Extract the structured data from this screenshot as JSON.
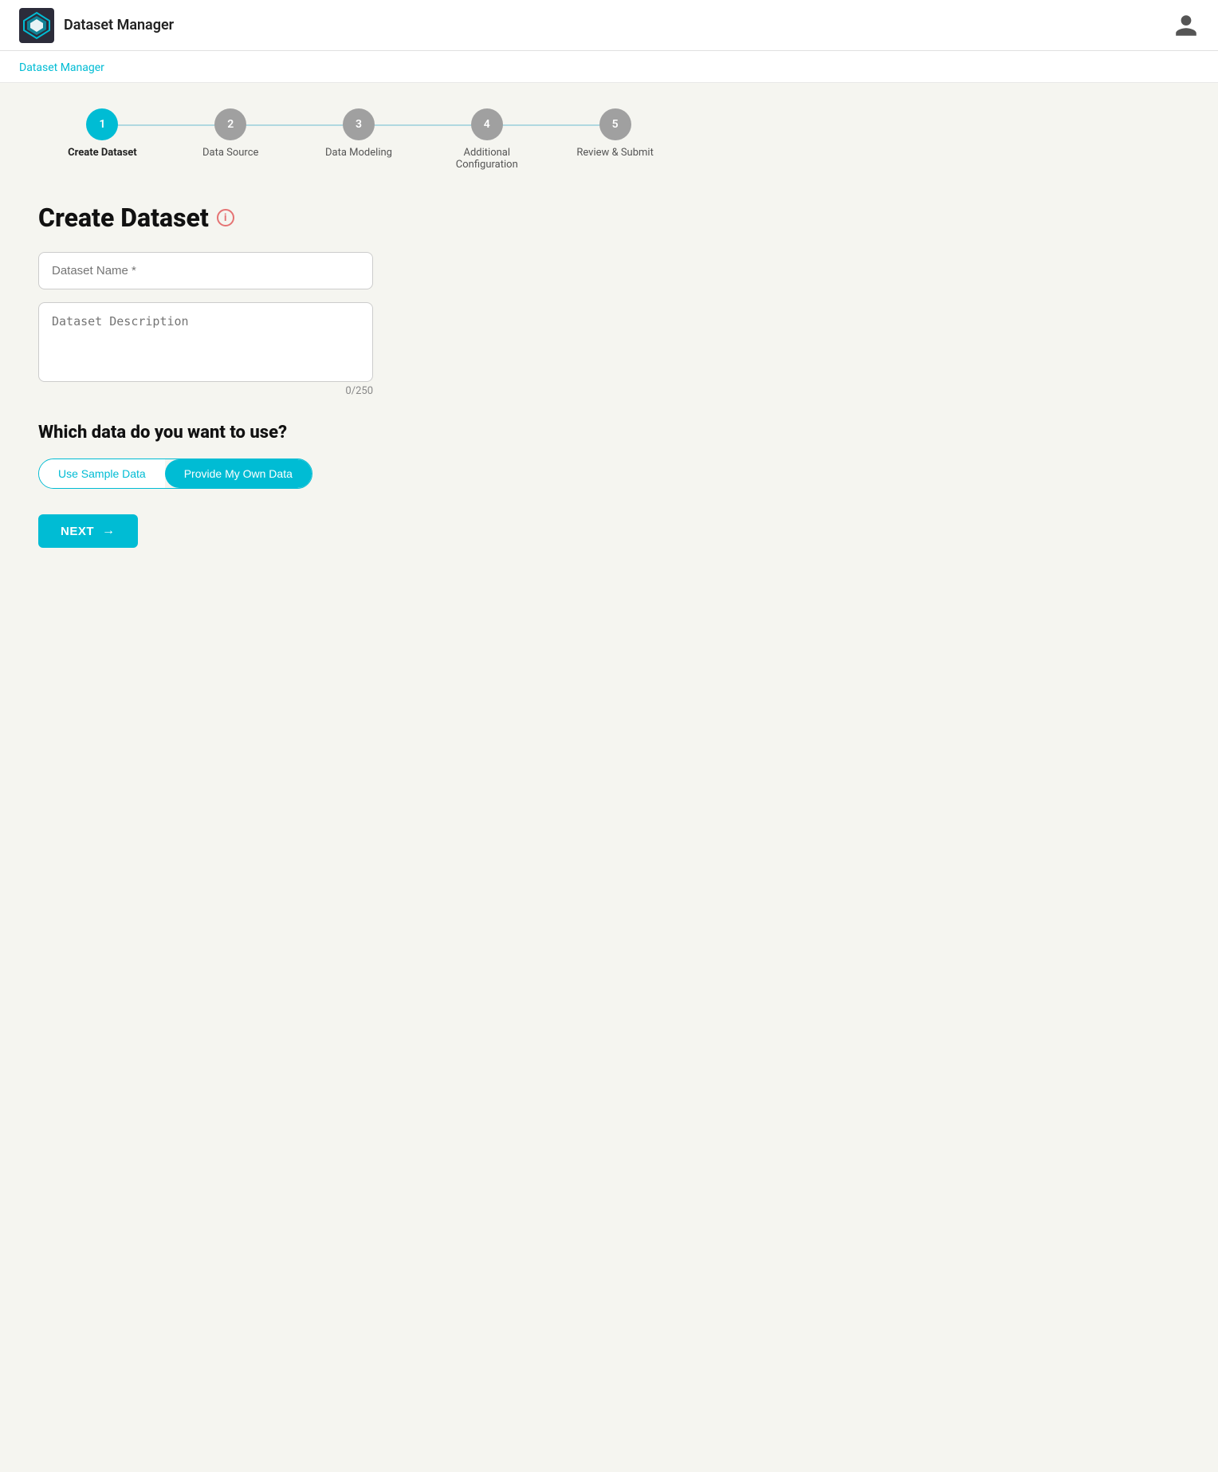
{
  "header": {
    "app_title": "Dataset Manager",
    "breadcrumb_label": "Dataset Manager"
  },
  "stepper": {
    "steps": [
      {
        "number": "1",
        "label": "Create Dataset",
        "state": "active"
      },
      {
        "number": "2",
        "label": "Data Source",
        "state": "inactive"
      },
      {
        "number": "3",
        "label": "Data Modeling",
        "state": "inactive"
      },
      {
        "number": "4",
        "label": "Additional Configuration",
        "state": "inactive"
      },
      {
        "number": "5",
        "label": "Review & Submit",
        "state": "inactive"
      }
    ]
  },
  "form": {
    "page_title": "Create Dataset",
    "info_icon_label": "i",
    "dataset_name_placeholder": "Dataset Name *",
    "dataset_description_placeholder": "Dataset Description",
    "char_count": "0/250"
  },
  "data_selection": {
    "section_title": "Which data do you want to use?",
    "option_sample": "Use Sample Data",
    "option_own": "Provide My Own Data",
    "active_option": "own"
  },
  "actions": {
    "next_label": "NEXT",
    "next_arrow": "→"
  }
}
